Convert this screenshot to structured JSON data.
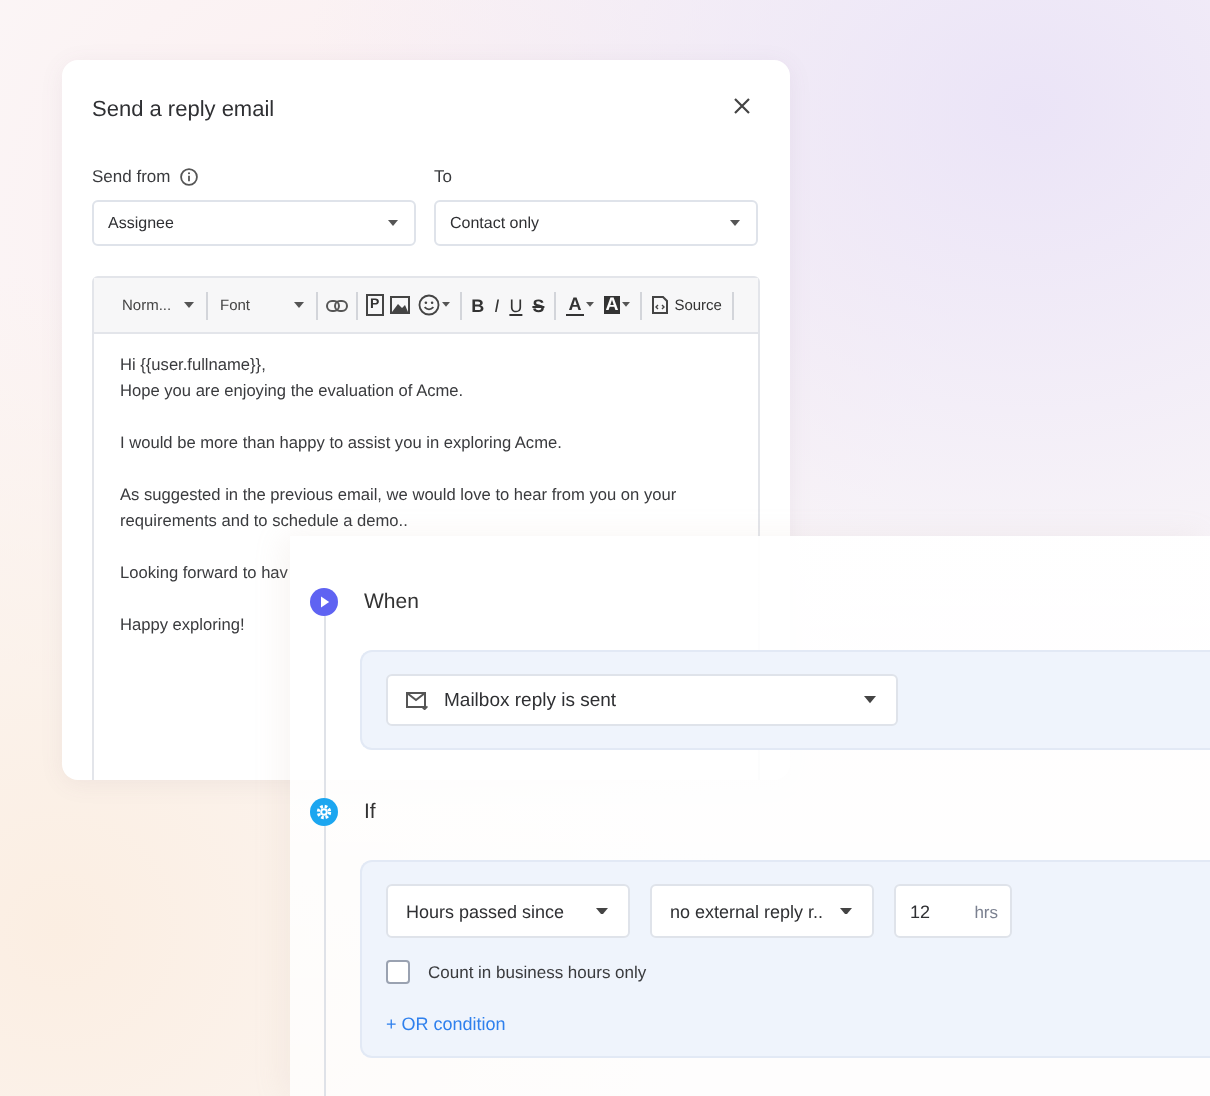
{
  "dialog": {
    "title": "Send a reply email",
    "fields": [
      {
        "label": "Send from",
        "info": true,
        "value": "Assignee"
      },
      {
        "label": "To",
        "info": false,
        "value": "Contact only"
      }
    ],
    "toolbar": [
      [
        {
          "kind": "dropdown",
          "label": "Norm..."
        }
      ],
      [
        {
          "kind": "dropdown",
          "label": "Font"
        }
      ],
      [
        {
          "kind": "link"
        }
      ],
      [
        {
          "kind": "boxed",
          "label": "P"
        },
        {
          "kind": "image"
        },
        {
          "kind": "emoji"
        }
      ],
      [
        {
          "kind": "bold",
          "label": "B"
        },
        {
          "kind": "italic",
          "label": "I"
        },
        {
          "kind": "underline",
          "label": "U"
        },
        {
          "kind": "strike",
          "label": "S"
        }
      ],
      [
        {
          "kind": "color",
          "label": "A"
        },
        {
          "kind": "highlight",
          "label": "A"
        }
      ],
      [
        {
          "kind": "source",
          "label": "Source"
        }
      ]
    ],
    "body": [
      [
        "Hi {{user.fullname}},",
        "Hope you are enjoying the evaluation of Acme."
      ],
      [
        "I would be more than happy to assist you in exploring Acme."
      ],
      [
        "As suggested in the previous email, we would love to hear from you on your requirements and to schedule a demo.."
      ],
      [
        "Looking forward to hav"
      ],
      [
        "Happy exploring!"
      ]
    ]
  },
  "workflow": {
    "steps": [
      {
        "kind": "trigger",
        "label": "When",
        "event": "Mailbox reply is sent"
      },
      {
        "kind": "condition",
        "label": "If",
        "selects": [
          "Hours passed since",
          "no external reply r.."
        ],
        "amount": {
          "value": "12",
          "unit": "hrs"
        },
        "option": {
          "label": "Count in business hours only",
          "checked": false
        },
        "add": "+ OR condition"
      }
    ]
  }
}
